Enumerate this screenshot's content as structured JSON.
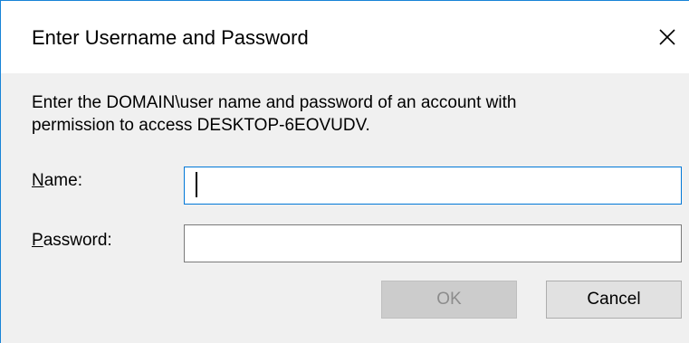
{
  "dialog": {
    "title": "Enter Username and Password",
    "close_icon": "close-x-icon",
    "message_line1": "Enter the DOMAIN\\user name and password of an account with",
    "message_line2": "permission to access DESKTOP-6EOVUDV.",
    "name_label_accel": "N",
    "name_label_rest": "ame:",
    "name_value": "",
    "password_label_accel": "P",
    "password_label_rest": "assword:",
    "password_value": "",
    "ok_label": "OK",
    "ok_enabled": false,
    "cancel_label": "Cancel"
  },
  "colors": {
    "accent": "#0078d7",
    "window_border": "#1883d7",
    "client_bg": "#f0f0f0",
    "disabled_text": "#8c8c8c"
  }
}
